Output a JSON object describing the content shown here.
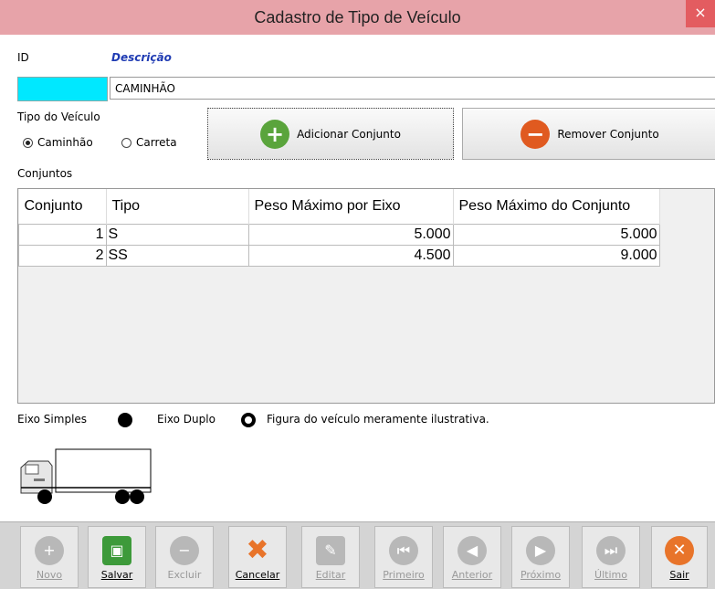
{
  "window": {
    "title": "Cadastro de Tipo de Veículo",
    "close": "×"
  },
  "form": {
    "id_label": "ID",
    "desc_label": "Descrição",
    "desc_value": "CAMINHÃO",
    "tipo_label": "Tipo do Veículo",
    "radio_caminhao": "Caminhão",
    "radio_carreta": "Carreta",
    "btn_add": "Adicionar Conjunto",
    "btn_remove": "Remover Conjunto",
    "conjuntos_label": "Conjuntos"
  },
  "table": {
    "headers": [
      "Conjunto",
      "Tipo",
      "Peso Máximo por Eixo",
      "Peso Máximo do Conjunto"
    ],
    "rows": [
      [
        "1",
        "S",
        "5.000",
        "5.000"
      ],
      [
        "2",
        "SS",
        "4.500",
        "9.000"
      ]
    ]
  },
  "legend": {
    "simple": "Eixo Simples",
    "double": "Eixo Duplo",
    "note": "Figura do veículo meramente ilustrativa."
  },
  "toolbar": {
    "novo": "Novo",
    "salvar": "Salvar",
    "excluir": "Excluir",
    "cancelar": "Cancelar",
    "editar": "Editar",
    "primeiro": "Primeiro",
    "anterior": "Anterior",
    "proximo": "Próximo",
    "ultimo": "Último",
    "sair": "Sair"
  }
}
